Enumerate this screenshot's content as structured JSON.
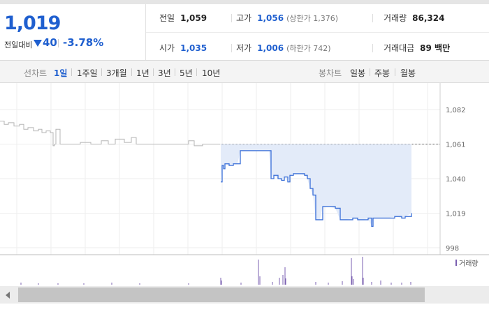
{
  "quote": {
    "price": "1,019",
    "change_label": "전일대비",
    "change_value": "40",
    "change_pct": "-3.78%",
    "prev_close_label": "전일",
    "prev_close": "1,059",
    "open_label": "시가",
    "open": "1,035",
    "high_label": "고가",
    "high": "1,056",
    "upper_limit": "(상한가 1,376)",
    "low_label": "저가",
    "low": "1,006",
    "lower_limit": "(하한가 742)",
    "volume_label": "거래량",
    "volume": "86,324",
    "amount_label": "거래대금",
    "amount": "89 백만"
  },
  "tabs": {
    "line_label": "선차트",
    "line_periods": [
      "1일",
      "1주일",
      "3개월",
      "1년",
      "3년",
      "5년",
      "10년"
    ],
    "selected": "1일",
    "candle_label": "봉차트",
    "candle_periods": [
      "일봉",
      "주봉",
      "월봉"
    ]
  },
  "chart_data": {
    "type": "line",
    "y_ticks": [
      "1,082",
      "1,061",
      "1,040",
      "1,019",
      "998"
    ],
    "ylim": [
      998,
      1082
    ],
    "prev_close": 1059,
    "prev_day_series": [
      [
        0,
        1075
      ],
      [
        6,
        1073
      ],
      [
        12,
        1074
      ],
      [
        20,
        1072
      ],
      [
        28,
        1073
      ],
      [
        34,
        1070
      ],
      [
        40,
        1071
      ],
      [
        48,
        1069
      ],
      [
        55,
        1070
      ],
      [
        60,
        1068
      ],
      [
        66,
        1069
      ],
      [
        72,
        1068
      ],
      [
        76,
        1060
      ],
      [
        78,
        1061
      ],
      [
        80,
        1070
      ],
      [
        86,
        1061
      ],
      [
        100,
        1061
      ],
      [
        115,
        1062
      ],
      [
        130,
        1061
      ],
      [
        145,
        1063
      ],
      [
        155,
        1061
      ],
      [
        165,
        1064
      ],
      [
        178,
        1062
      ],
      [
        188,
        1065
      ],
      [
        195,
        1061
      ],
      [
        205,
        1061
      ],
      [
        225,
        1061
      ],
      [
        245,
        1061
      ],
      [
        262,
        1061
      ],
      [
        270,
        1063
      ],
      [
        278,
        1060
      ],
      [
        290,
        1061
      ],
      [
        300,
        1061
      ],
      [
        315,
        1061
      ]
    ],
    "today_series": [
      [
        316,
        1038
      ],
      [
        318,
        1048
      ],
      [
        320,
        1046
      ],
      [
        322,
        1049
      ],
      [
        328,
        1048
      ],
      [
        334,
        1049
      ],
      [
        340,
        1049
      ],
      [
        344,
        1057
      ],
      [
        350,
        1057
      ],
      [
        360,
        1057
      ],
      [
        370,
        1057
      ],
      [
        385,
        1057
      ],
      [
        388,
        1040
      ],
      [
        392,
        1042
      ],
      [
        398,
        1040
      ],
      [
        403,
        1039
      ],
      [
        407,
        1041
      ],
      [
        412,
        1038
      ],
      [
        415,
        1042
      ],
      [
        420,
        1043
      ],
      [
        430,
        1043
      ],
      [
        436,
        1042
      ],
      [
        440,
        1040
      ],
      [
        444,
        1034
      ],
      [
        448,
        1030
      ],
      [
        452,
        1015
      ],
      [
        458,
        1015
      ],
      [
        462,
        1023
      ],
      [
        470,
        1023
      ],
      [
        480,
        1022
      ],
      [
        487,
        1015
      ],
      [
        495,
        1015
      ],
      [
        505,
        1016
      ],
      [
        512,
        1015
      ],
      [
        520,
        1015
      ],
      [
        527,
        1016
      ],
      [
        532,
        1011
      ],
      [
        534,
        1016
      ],
      [
        545,
        1016
      ],
      [
        555,
        1016
      ],
      [
        565,
        1017
      ],
      [
        575,
        1016
      ],
      [
        580,
        1017
      ],
      [
        589,
        1019
      ]
    ],
    "volume_label": "거래량",
    "volume_series": [
      [
        30,
        3
      ],
      [
        55,
        2
      ],
      [
        83,
        2
      ],
      [
        120,
        2
      ],
      [
        160,
        3
      ],
      [
        200,
        2
      ],
      [
        270,
        2
      ],
      [
        316,
        10
      ],
      [
        317,
        6
      ],
      [
        345,
        3
      ],
      [
        370,
        36
      ],
      [
        372,
        12
      ],
      [
        390,
        4
      ],
      [
        400,
        10
      ],
      [
        405,
        14
      ],
      [
        408,
        25
      ],
      [
        409,
        9
      ],
      [
        452,
        4
      ],
      [
        470,
        3
      ],
      [
        490,
        5
      ],
      [
        503,
        38
      ],
      [
        504,
        12
      ],
      [
        506,
        8
      ],
      [
        519,
        40
      ],
      [
        520,
        10
      ],
      [
        532,
        4
      ],
      [
        545,
        6
      ],
      [
        560,
        3
      ],
      [
        575,
        3
      ],
      [
        588,
        4
      ]
    ]
  }
}
